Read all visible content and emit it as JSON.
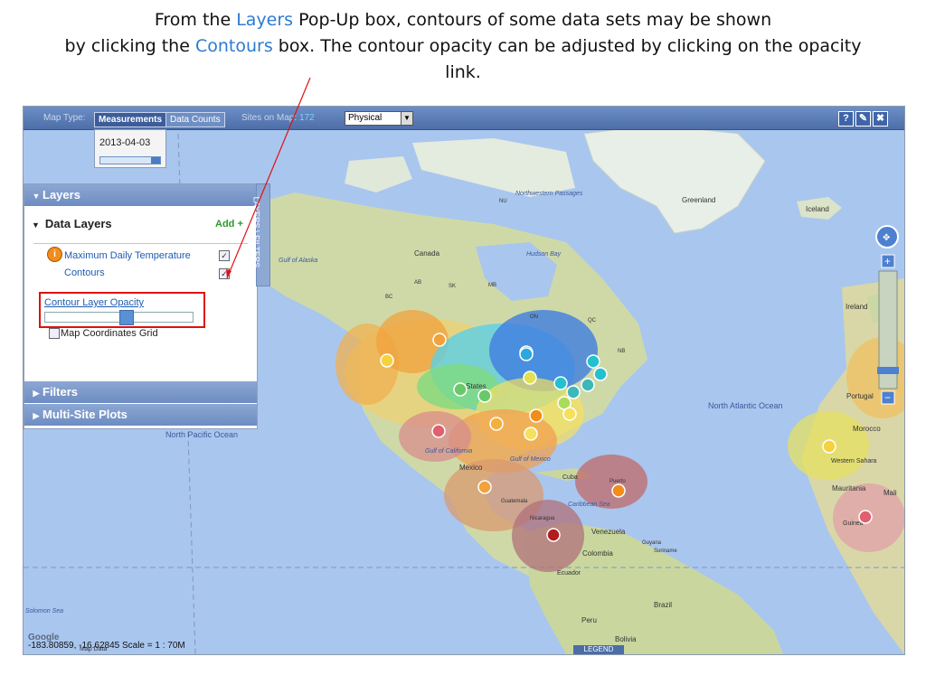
{
  "caption": {
    "l1a": "From the ",
    "l1b": "Layers",
    "l1c": " Pop-Up box, contours of some data sets may be shown",
    "l2a": "by clicking the ",
    "l2b": "Contours",
    "l2c": " box. The contour opacity can be adjusted by clicking on the opacity",
    "l3": "link."
  },
  "toolbar": {
    "map_type_label": "Map Type:",
    "tab_measurements": "Measurements",
    "tab_data_counts": "Data Counts",
    "sites_label": "Sites on Map:",
    "sites_count": "172",
    "base_map_selected": "Physical",
    "help_icon": "?",
    "close_icon": "✖",
    "edit_icon": "✎"
  },
  "date": {
    "value": "2013-04-03",
    "slider_fraction": 0.15
  },
  "layers_panel": {
    "header": "Layers",
    "data_layers_title": "Data Layers",
    "add_label": "Add +",
    "layer_name": "Maximum Daily Temperature",
    "contours_label": "Contours",
    "opacity_link": "Contour Layer Opacity",
    "opacity_fraction": 0.55,
    "grid_label": "Map Coordinates Grid",
    "filters_header": "Filters",
    "multisite_header": "Multi-Site Plots",
    "vertical_tab": "LAYERS \\ FILTERS"
  },
  "map_labels": {
    "greenland": "Greenland",
    "iceland": "Iceland",
    "canada": "Canada",
    "nw_passages": "Northwestern Passages",
    "hudson_bay": "Hudson Bay",
    "gulf_alaska": "Gulf of Alaska",
    "north_atlantic": "North Atlantic Ocean",
    "north_pacific": "North Pacific Ocean",
    "mexico": "Mexico",
    "gulf_mexico": "Gulf of Mexico",
    "gulf_california": "Gulf of California",
    "cuba": "Cuba",
    "caribbean": "Caribbean Sea",
    "venezuela": "Venezuela",
    "colombia": "Colombia",
    "brazil": "Brazil",
    "peru": "Peru",
    "bolivia": "Bolivia",
    "ireland": "Ireland",
    "portugal": "Portugal",
    "morocco": "Morocco",
    "western_sahara": "Western Sahara",
    "mauritania": "Mauritania",
    "mali": "Mali",
    "guinea": "Guinea",
    "solomon_sea": "Solomon Sea",
    "ecuador": "Ecuador",
    "guyana": "Guyana",
    "suriname": "Suriname",
    "puerto": "Puerto",
    "guatemala": "Guatemala",
    "nicaragua": "Nicaragua",
    "united_states": "ed States",
    "nu": "NU",
    "qc": "QC",
    "on": "ON",
    "mb": "MB",
    "ab": "AB",
    "bc": "BC",
    "sk": "SK",
    "nb": "NB"
  },
  "status": {
    "coords": "-183.80859, -16.62845 Scale = 1 : 70M",
    "google": "Google",
    "map_data": "Map Data",
    "legend": "LEGEND"
  },
  "colors": {
    "accent_blue": "#2e7bd0",
    "highlight_red": "#e01010",
    "ocean": "#a9c6ee",
    "land": "#c9d8a4",
    "toolbar": "#4d6ea8"
  }
}
